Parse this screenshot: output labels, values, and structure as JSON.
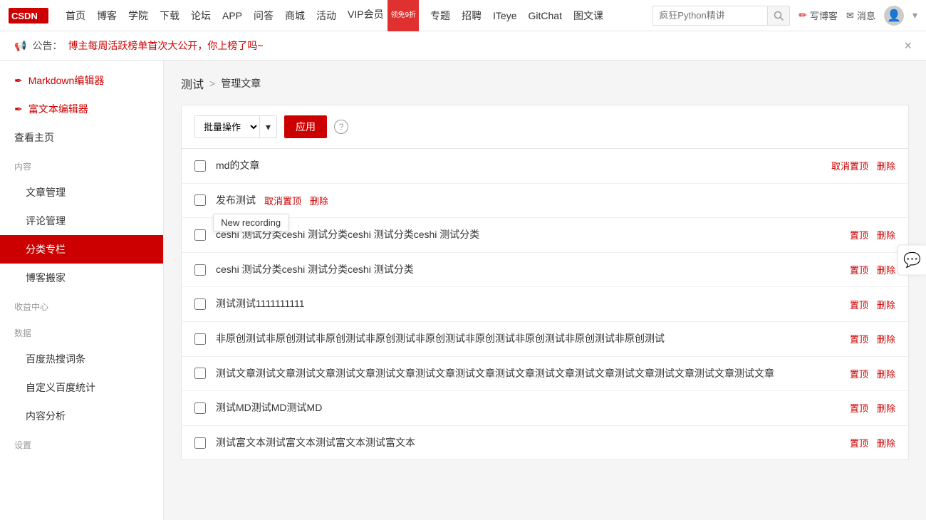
{
  "topnav": {
    "logo_text": "CSDN",
    "links": [
      "首页",
      "博客",
      "学院",
      "下载",
      "论坛",
      "APP",
      "问答",
      "商城",
      "活动",
      "VIP会员",
      "专题",
      "招聘",
      "ITeye",
      "GitChat",
      "图文课"
    ],
    "vip_label": "VIP会员",
    "badge_text": "领免9折",
    "search_placeholder": "疯狂Python精讲",
    "write_label": "写博客",
    "message_label": "消息"
  },
  "announcement": {
    "prefix": "📢 公告：",
    "link_text": "博主每周活跃榜单首次大公开，你上榜了吗~"
  },
  "sidebar": {
    "markdown_label": "Markdown编辑器",
    "richtext_label": "富文本编辑器",
    "viewhome_label": "查看主页",
    "sections": {
      "content_label": "内容",
      "earnings_label": "收益中心",
      "data_label": "数据",
      "settings_label": "设置"
    },
    "content_items": [
      "文章管理",
      "评论管理",
      "分类专栏",
      "博客搬家"
    ],
    "data_items": [
      "百度热搜词条",
      "自定义百度统计",
      "内容分析"
    ]
  },
  "breadcrumb": {
    "current": "测试",
    "sep": ">",
    "sub": "管理文章"
  },
  "toolbar": {
    "batch_label": "批量操作",
    "apply_label": "应用",
    "help_symbol": "?"
  },
  "articles": [
    {
      "id": 1,
      "title": "md的文章",
      "action1": "取消置顶",
      "action2": "删除",
      "has_tooltip": false
    },
    {
      "id": 2,
      "title": "发布测试",
      "action1": "取消置顶",
      "action2": "删除",
      "has_tooltip": true,
      "tooltip_text": "New recording"
    },
    {
      "id": 3,
      "title": "ceshi 测试分类ceshi 测试分类ceshi 测试分类ceshi 测试分类",
      "action1": "置顶",
      "action2": "删除",
      "has_tooltip": false
    },
    {
      "id": 4,
      "title": "ceshi 测试分类ceshi 测试分类ceshi 测试分类",
      "action1": "置顶",
      "action2": "删除",
      "has_tooltip": false
    },
    {
      "id": 5,
      "title": "测试测试1111111111",
      "action1": "置顶",
      "action2": "删除",
      "has_tooltip": false
    },
    {
      "id": 6,
      "title": "非原创测试非原创测试非原创测试非原创测试非原创测试非原创测试非原创测试非原创测试非原创测试",
      "action1": "置顶",
      "action2": "删除",
      "has_tooltip": false
    },
    {
      "id": 7,
      "title": "测试文章测试文章测试文章测试文章测试文章测试文章测试文章测试文章测试文章测试文章测试文章测试文章测试文章测试文章",
      "action1": "置顶",
      "action2": "删除",
      "has_tooltip": false
    },
    {
      "id": 8,
      "title": "测试MD测试MD测试MD",
      "action1": "置顶",
      "action2": "删除",
      "has_tooltip": false
    },
    {
      "id": 9,
      "title": "测试富文本测试富文本测试富文本测试富文本",
      "action1": "置顶",
      "action2": "删除",
      "has_tooltip": false
    }
  ]
}
